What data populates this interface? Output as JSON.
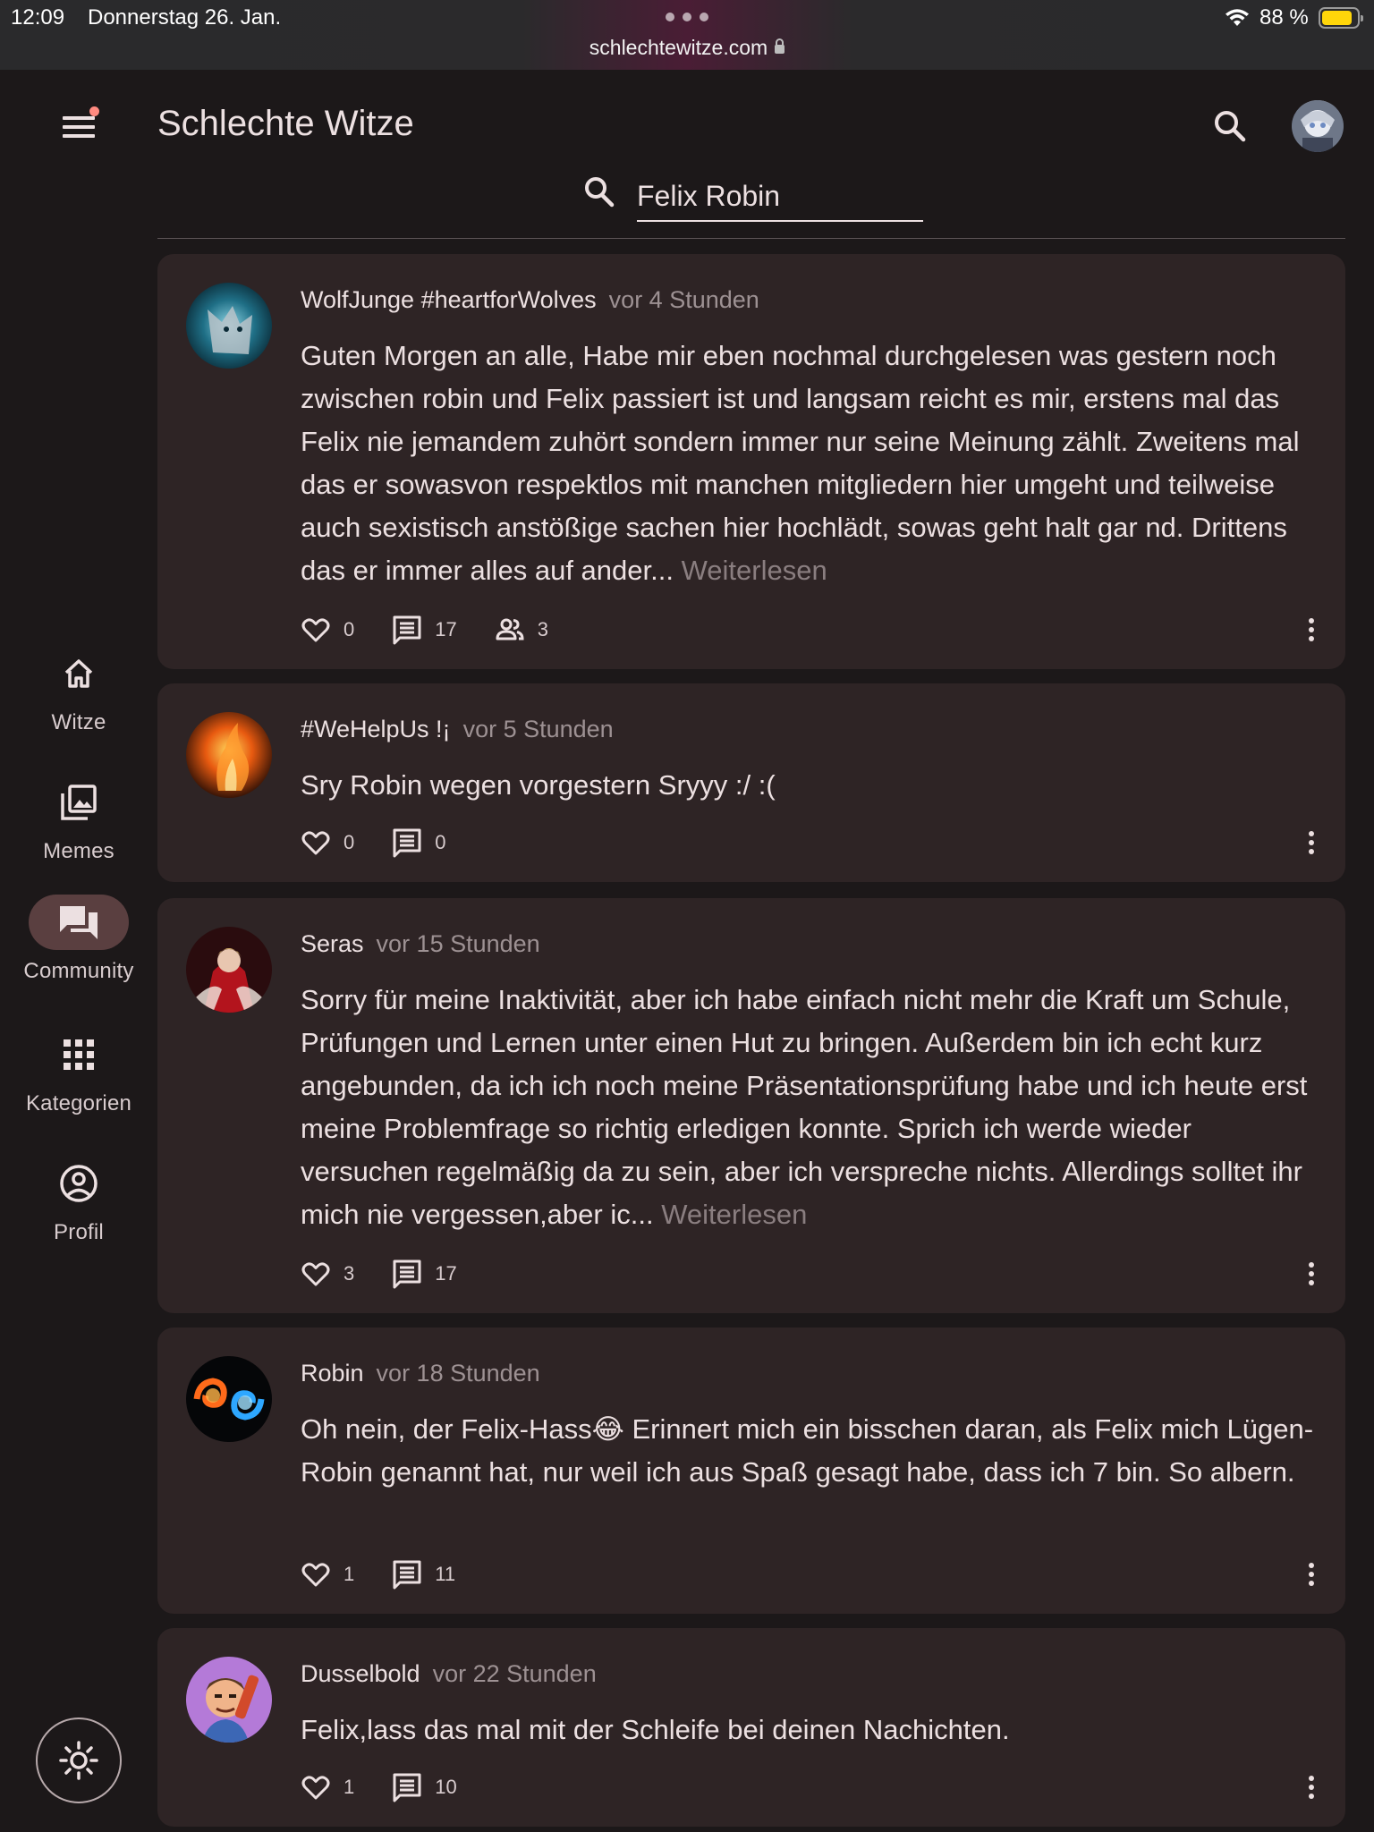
{
  "statusbar": {
    "time": "12:09",
    "date": "Donnerstag 26. Jan.",
    "url": "schlechtewitze.com",
    "battery": "88 %",
    "battery_color": "#ffd60a"
  },
  "appbar": {
    "title": "Schlechte Witze",
    "menu_icon": "menu-icon",
    "search_icon": "search-icon"
  },
  "search": {
    "value": "Felix Robin"
  },
  "nav": {
    "items": [
      {
        "label": "Witze",
        "icon": "home-icon",
        "active": false
      },
      {
        "label": "Memes",
        "icon": "image-gallery-icon",
        "active": false
      },
      {
        "label": "Community",
        "icon": "forum-icon",
        "active": true
      },
      {
        "label": "Kategorien",
        "icon": "grid-icon",
        "active": false
      },
      {
        "label": "Profil",
        "icon": "account-circle-icon",
        "active": false
      }
    ],
    "theme_icon": "brightness-icon"
  },
  "posts": [
    {
      "author": "WolfJunge #heartforWolves",
      "time": "vor 4 Stunden",
      "text": "Guten Morgen an alle, Habe mir eben nochmal durchgelesen was gestern noch zwischen robin und Felix passiert ist und langsam reicht es mir, erstens mal das Felix nie jemandem zuhört sondern immer nur seine Meinung zählt. Zweitens mal das er sowasvon respektlos mit manchen mitgliedern hier umgeht und teilweise auch sexistisch anstößige sachen hier hochlädt, sowas geht halt gar nd. Drittens das er immer alles auf ander...",
      "more": "Weiterlesen",
      "likes": "0",
      "comments": "17",
      "participants": "3"
    },
    {
      "author": "#WeHelpUs !¡",
      "time": "vor 5 Stunden",
      "text": "Sry Robin wegen vorgestern Sryyy :/ :(",
      "likes": "0",
      "comments": "0"
    },
    {
      "author": "Seras",
      "time": "vor 15 Stunden",
      "text": "Sorry für meine Inaktivität, aber ich habe einfach nicht mehr die Kraft um Schule, Prüfungen und Lernen unter einen Hut zu bringen. Außerdem bin ich echt kurz angebunden, da ich ich noch meine Präsentationsprüfung habe und ich heute erst meine Problemfrage so richtig erledigen konnte. Sprich ich werde wieder versuchen regelmäßig da zu sein, aber ich verspreche nichts. Allerdings solltet ihr mich nie vergessen,aber ic...",
      "more": "Weiterlesen",
      "likes": "3",
      "comments": "17"
    },
    {
      "author": "Robin",
      "time": "vor 18 Stunden",
      "text": "Oh nein, der Felix-Hass😂 Erinnert mich ein bisschen daran, als Felix mich Lügen-Robin genannt hat, nur weil ich aus Spaß gesagt habe, dass ich 7 bin. So albern.",
      "likes": "1",
      "comments": "11"
    },
    {
      "author": "Dusselbold",
      "time": "vor 22 Stunden",
      "text": "Felix,lass das mal mit der Schleife bei deinen Nachichten.",
      "likes": "1",
      "comments": "10"
    }
  ],
  "colors": {
    "background": "#1c1819",
    "card": "#2e2425",
    "active_nav": "#5a3f40",
    "muted_text": "#9d9193",
    "notification_dot": "#ff8a80"
  }
}
